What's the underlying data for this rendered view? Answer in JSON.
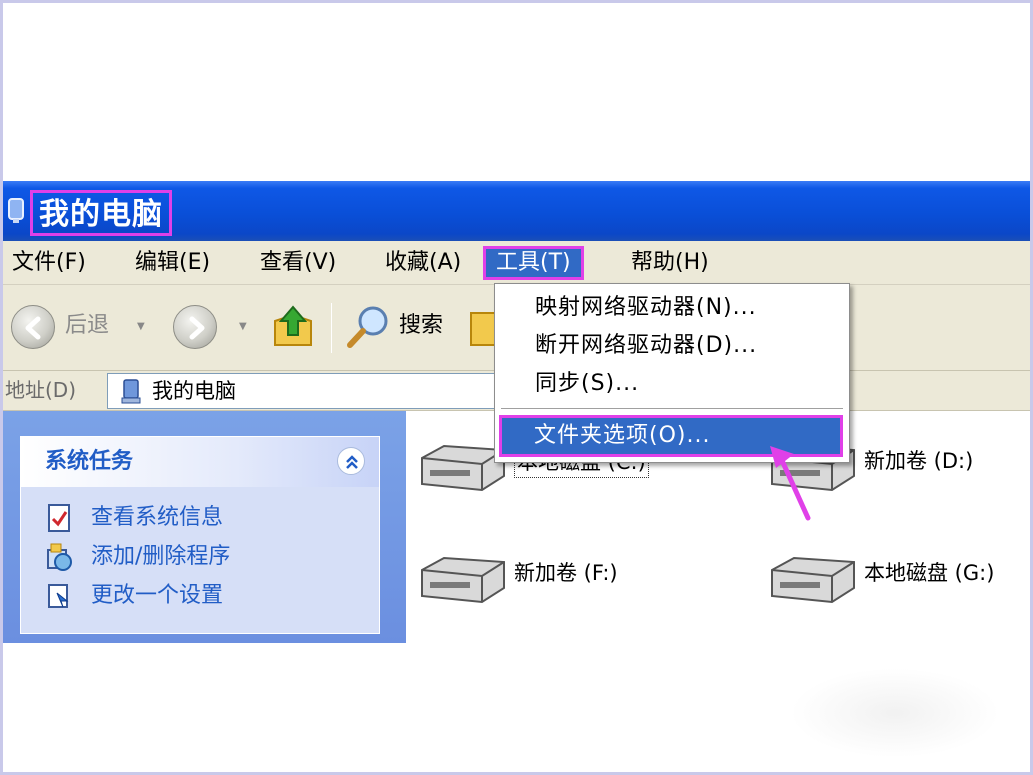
{
  "window": {
    "title": "我的电脑"
  },
  "menubar": {
    "items": [
      "文件(F)",
      "编辑(E)",
      "查看(V)",
      "收藏(A)",
      "工具(T)",
      "帮助(H)"
    ]
  },
  "toolbar": {
    "back_label": "后退",
    "search_label": "搜索"
  },
  "address": {
    "label": "地址(D)",
    "value": "我的电脑"
  },
  "tools_menu": {
    "items": [
      "映射网络驱动器(N)...",
      "断开网络驱动器(D)...",
      "同步(S)..."
    ],
    "selected": "文件夹选项(O)..."
  },
  "tasks": {
    "title": "系统任务",
    "items": [
      "查看系统信息",
      "添加/删除程序",
      "更改一个设置"
    ]
  },
  "drives": [
    {
      "label": "本地磁盘 (C:)",
      "icon": "hard-drive-icon"
    },
    {
      "label": "新加卷 (D:)",
      "icon": "hard-drive-icon"
    },
    {
      "label": "新加卷 (F:)",
      "icon": "hard-drive-icon"
    },
    {
      "label": "本地磁盘 (G:)",
      "icon": "hard-drive-icon"
    }
  ],
  "colors": {
    "titlebar": "#0a4fd8",
    "highlight": "#316ac5",
    "annotation": "#e040e8",
    "task_link": "#215dc6"
  }
}
